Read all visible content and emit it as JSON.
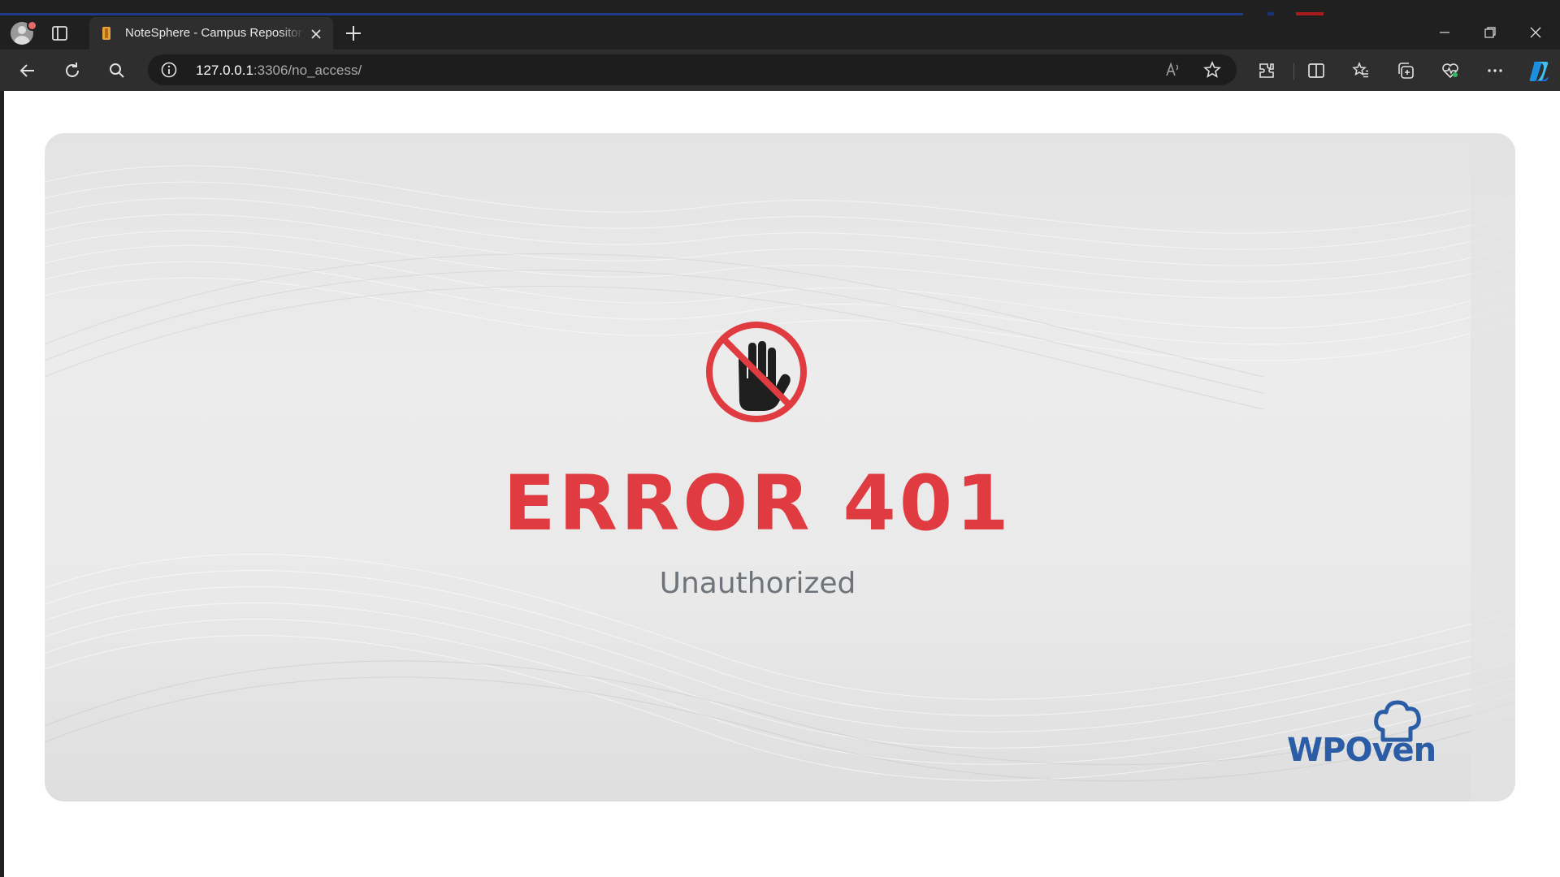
{
  "browser": {
    "tab": {
      "title": "NoteSphere - Campus Repository",
      "favicon": "notebook-icon"
    },
    "address": {
      "host": "127.0.0.1",
      "path": ":3306/no_access/"
    },
    "toolbar_icons": [
      "back-icon",
      "refresh-icon",
      "search-icon",
      "info-icon",
      "read-aloud-icon",
      "favorite-star-icon",
      "extensions-icon",
      "split-screen-icon",
      "favorites-icon",
      "collections-icon",
      "browser-essentials-icon",
      "more-icon",
      "copilot-icon"
    ],
    "window_controls": [
      "minimize-icon",
      "restore-icon",
      "close-icon"
    ]
  },
  "page": {
    "error_title": "ERROR 401",
    "error_subtitle": "Unauthorized",
    "brand": "WPOven",
    "colors": {
      "error_red": "#df3b40",
      "brand_blue": "#2a5da6",
      "subtitle_gray": "#6f747a"
    }
  }
}
